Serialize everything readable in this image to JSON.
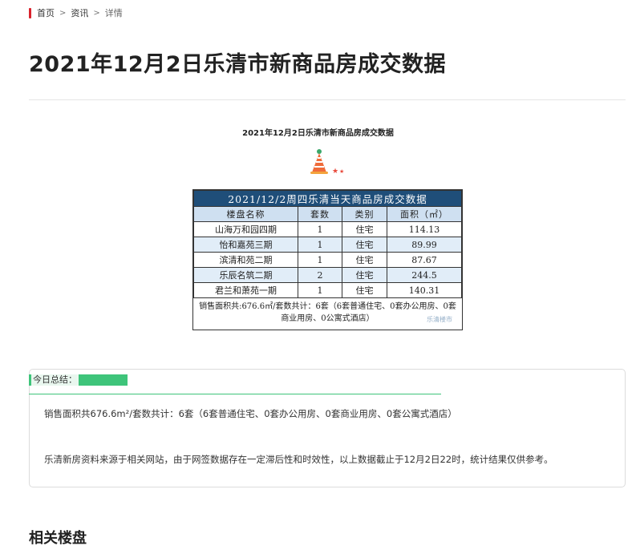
{
  "breadcrumb": {
    "home": "首页",
    "news": "资讯",
    "current": "详情",
    "separator": ">"
  },
  "article": {
    "title": "2021年12月2日乐清市新商品房成交数据",
    "image_caption": "2021年12月2日乐清市新商品房成交数据"
  },
  "table": {
    "header": "2021/12/2周四乐清当天商品房成交数据",
    "columns": [
      "楼盘名称",
      "套数",
      "类别",
      "面积（㎡）"
    ],
    "rows": [
      [
        "山海万和园四期",
        "1",
        "住宅",
        "114.13"
      ],
      [
        "怡和嘉苑三期",
        "1",
        "住宅",
        "89.99"
      ],
      [
        "滨清和苑二期",
        "1",
        "住宅",
        "87.67"
      ],
      [
        "乐辰名筑二期",
        "2",
        "住宅",
        "244.5"
      ],
      [
        "君兰和萧苑一期",
        "1",
        "住宅",
        "140.31"
      ]
    ],
    "footer": "销售面积共:676.6㎡/套数共计：6套（6套普通住宅、0套办公用房、0套商业用房、0公寓式酒店）",
    "watermark": "乐清楼市"
  },
  "summary": {
    "label": "今日总结：",
    "line1": "销售面积共676.6m²/套数共计：6套（6套普通住宅、0套办公用房、0套商业用房、0套公寓式酒店）",
    "line2": "乐清新房资料来源于相关网站，由于网签数据存在一定滞后性和时效性，以上数据截止于12月2日22时，统计结果仅供参考。"
  },
  "related": {
    "title": "相关楼盘"
  },
  "colors": {
    "accent_red": "#d9232d",
    "table_header": "#1f4e79",
    "summary_green": "#3ec47a"
  }
}
